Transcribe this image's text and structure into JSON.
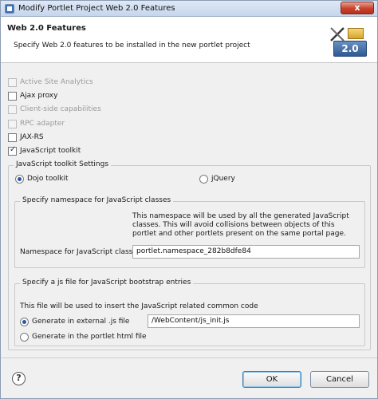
{
  "window": {
    "title": "Modify Portlet Project Web 2.0 Features",
    "close_label": "x"
  },
  "banner": {
    "title": "Web 2.0 Features",
    "description": "Specify Web 2.0 features to be installed in the new portlet project",
    "badge_text": "2.0"
  },
  "features": [
    {
      "label": "Active Site Analytics",
      "checked": false,
      "enabled": false
    },
    {
      "label": "Ajax proxy",
      "checked": false,
      "enabled": true
    },
    {
      "label": "Client-side capabilities",
      "checked": false,
      "enabled": false
    },
    {
      "label": "RPC adapter",
      "checked": false,
      "enabled": false
    },
    {
      "label": "JAX-RS",
      "checked": false,
      "enabled": true
    },
    {
      "label": "JavaScript toolkit",
      "checked": true,
      "enabled": true
    }
  ],
  "toolkit_group": {
    "title": "JavaScript toolkit Settings",
    "options": [
      {
        "label": "Dojo toolkit",
        "selected": true
      },
      {
        "label": "jQuery",
        "selected": false
      }
    ]
  },
  "namespace_group": {
    "title": "Specify namespace for JavaScript classes",
    "info": "This namespace will be used by all the generated JavaScript classes. This will avoid collisions between objects of this portlet and other portlets present on the same portal page.",
    "field_label": "Namespace for JavaScript classes",
    "field_value": "portlet.namespace_282b8dfe84"
  },
  "bootstrap_group": {
    "title": "Specify a js file for JavaScript bootstrap entries",
    "info": "This file will be used to insert the JavaScript related common code",
    "options": [
      {
        "label": "Generate in external .js file",
        "selected": true
      },
      {
        "label": "Generate in the portlet html file",
        "selected": false
      }
    ],
    "file_value": "/WebContent/js_init.js"
  },
  "footer": {
    "help_label": "?",
    "ok_label": "OK",
    "cancel_label": "Cancel"
  }
}
